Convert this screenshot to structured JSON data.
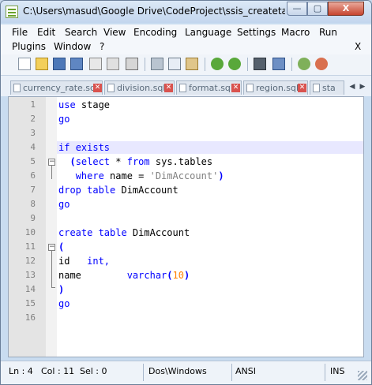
{
  "window": {
    "title": "C:\\Users\\masud\\Google Drive\\CodeProject\\ssis_createtable_..."
  },
  "window_controls": {
    "minimize": "—",
    "maximize": "▢",
    "close": "X"
  },
  "menu": {
    "items": [
      "File",
      "Edit",
      "Search",
      "View",
      "Encoding",
      "Language",
      "Settings",
      "Macro",
      "Run",
      "Plugins",
      "Window",
      "?"
    ],
    "close_label": "X"
  },
  "toolbar": {
    "icons": [
      "new-file-icon",
      "open-file-icon",
      "save-icon",
      "save-all-icon",
      "close-icon",
      "close-all-icon",
      "print-icon",
      "cut-icon",
      "copy-icon",
      "paste-icon",
      "undo-icon",
      "redo-icon",
      "find-icon",
      "replace-icon",
      "zoom-in-icon",
      "zoom-out-icon"
    ]
  },
  "tabs": [
    {
      "label": "currency_rate.sql"
    },
    {
      "label": "division.sql"
    },
    {
      "label": "format.sql"
    },
    {
      "label": "region.sql"
    },
    {
      "label": "sta"
    }
  ],
  "editor": {
    "line_numbers": [
      "1",
      "2",
      "3",
      "4",
      "5",
      "6",
      "7",
      "8",
      "9",
      "10",
      "11",
      "12",
      "13",
      "14",
      "15",
      "16"
    ]
  },
  "status": {
    "ln": "Ln : 4",
    "col": "Col : 11",
    "sel": "Sel : 0",
    "eol": "Dos\\Windows",
    "encoding": "ANSI",
    "mode": "INS"
  },
  "colors": {
    "keyword": "#0000ff",
    "string": "#808080",
    "number": "#ff8000",
    "current_line": "#e8e8ff",
    "gutter": "#e4e4e4"
  }
}
